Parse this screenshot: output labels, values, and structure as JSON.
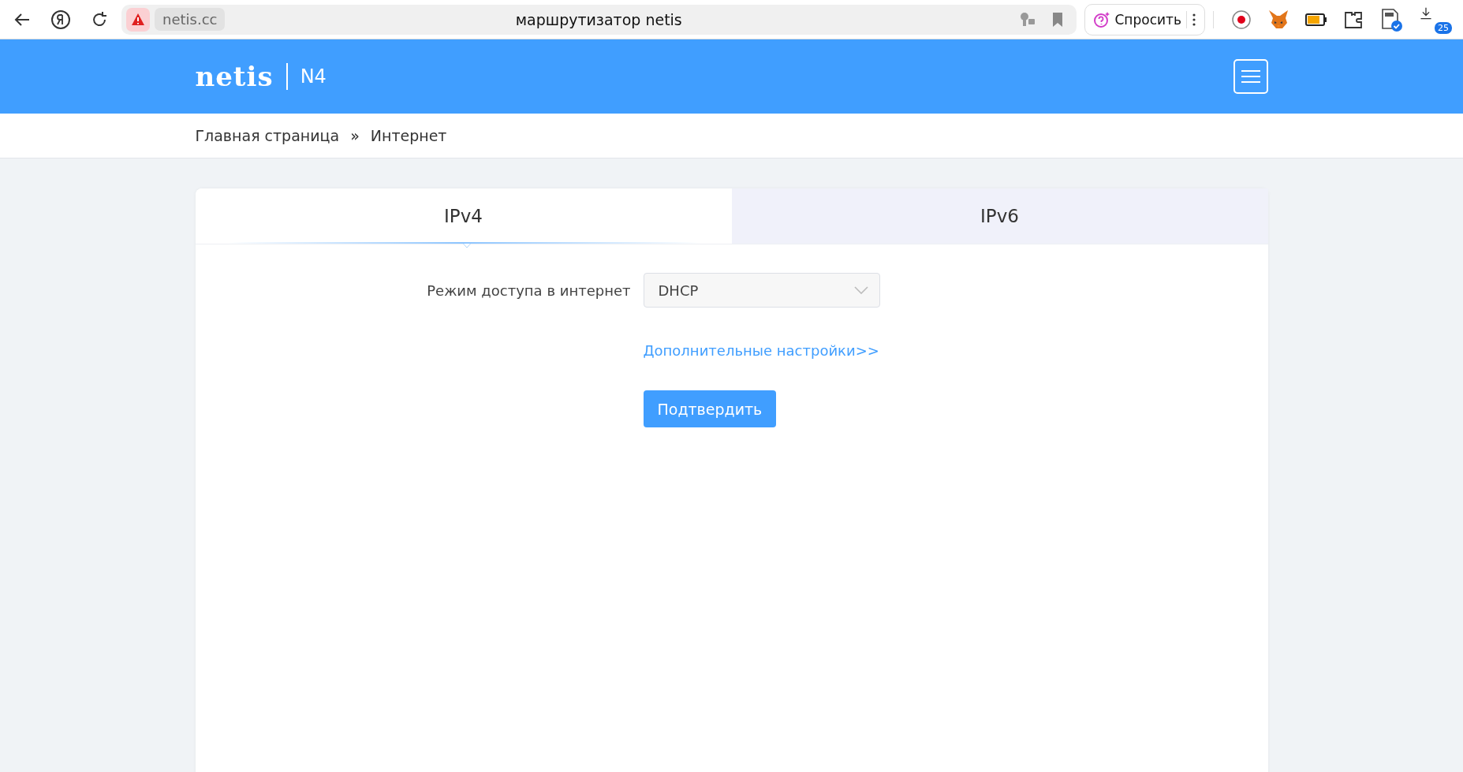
{
  "browser": {
    "address": "netis.cc",
    "title": "маршрутизатор netis",
    "ask_button": "Спросить",
    "downloads_badge": "25"
  },
  "header": {
    "logo": "netis",
    "model": "N4"
  },
  "breadcrumb": [
    "Главная страница",
    "»",
    "Интернет"
  ],
  "tabs": [
    {
      "label": "IPv4",
      "selected": true
    },
    {
      "label": "IPv6",
      "selected": false
    }
  ],
  "form": {
    "mode_label": "Режим доступа в интернет",
    "mode_value": "DHCP",
    "advanced_link": "Дополнительные настройки>>",
    "submit": "Подтвердить"
  }
}
